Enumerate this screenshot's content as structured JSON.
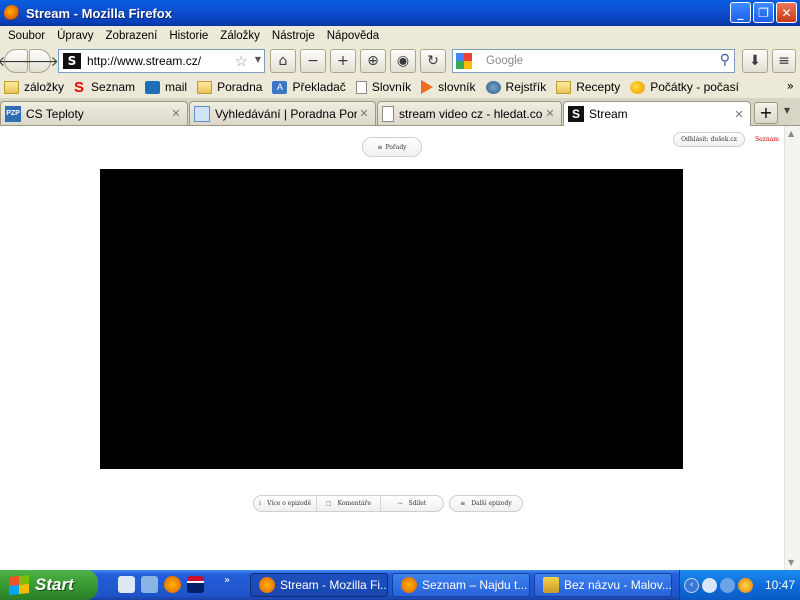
{
  "window": {
    "title": "Stream - Mozilla Firefox"
  },
  "menu": [
    "Soubor",
    "Úpravy",
    "Zobrazení",
    "Historie",
    "Záložky",
    "Nástroje",
    "Nápověda"
  ],
  "nav": {
    "url": "http://www.stream.cz/",
    "search_placeholder": "Google"
  },
  "bookmarks": [
    {
      "label": "záložky",
      "icon": "folder-icon"
    },
    {
      "label": "Seznam",
      "icon": "seznam-icon"
    },
    {
      "label": "mail",
      "icon": "mail-icon"
    },
    {
      "label": "Poradna",
      "icon": "folder-icon"
    },
    {
      "label": "Překladač",
      "icon": "translator-icon"
    },
    {
      "label": "Slovník",
      "icon": "page-icon"
    },
    {
      "label": "slovník",
      "icon": "play-icon"
    },
    {
      "label": "Rejstřík",
      "icon": "registry-icon"
    },
    {
      "label": "Recepty",
      "icon": "folder-icon"
    },
    {
      "label": "Počátky - počasí",
      "icon": "weather-icon"
    }
  ],
  "tabs": [
    {
      "label": "CS Teploty",
      "icon_text": "PZP"
    },
    {
      "label": "Vyhledávání | Poradna Pora...",
      "icon_text": ""
    },
    {
      "label": "stream video cz - hledat.com",
      "icon_text": ""
    },
    {
      "label": "Stream",
      "icon_text": "S"
    }
  ],
  "page": {
    "shows_label": "Pořady",
    "logout_label": "Odhlásit: dušek.cz",
    "seznam_label": "Seznam",
    "controls": {
      "about": "Více o epizodě",
      "comments": "Komentáře",
      "share": "Sdílet",
      "next": "Další epizody"
    }
  },
  "taskbar": {
    "start_label": "Start",
    "tasks": [
      {
        "label": "Stream - Mozilla Fi..."
      },
      {
        "label": "Seznam – Najdu t..."
      },
      {
        "label": "Bez názvu - Malov..."
      }
    ],
    "clock": "10:47"
  },
  "colors": {
    "video_bg": "#000000",
    "titlebar": "#0a4fd0",
    "start": "#379a33"
  }
}
